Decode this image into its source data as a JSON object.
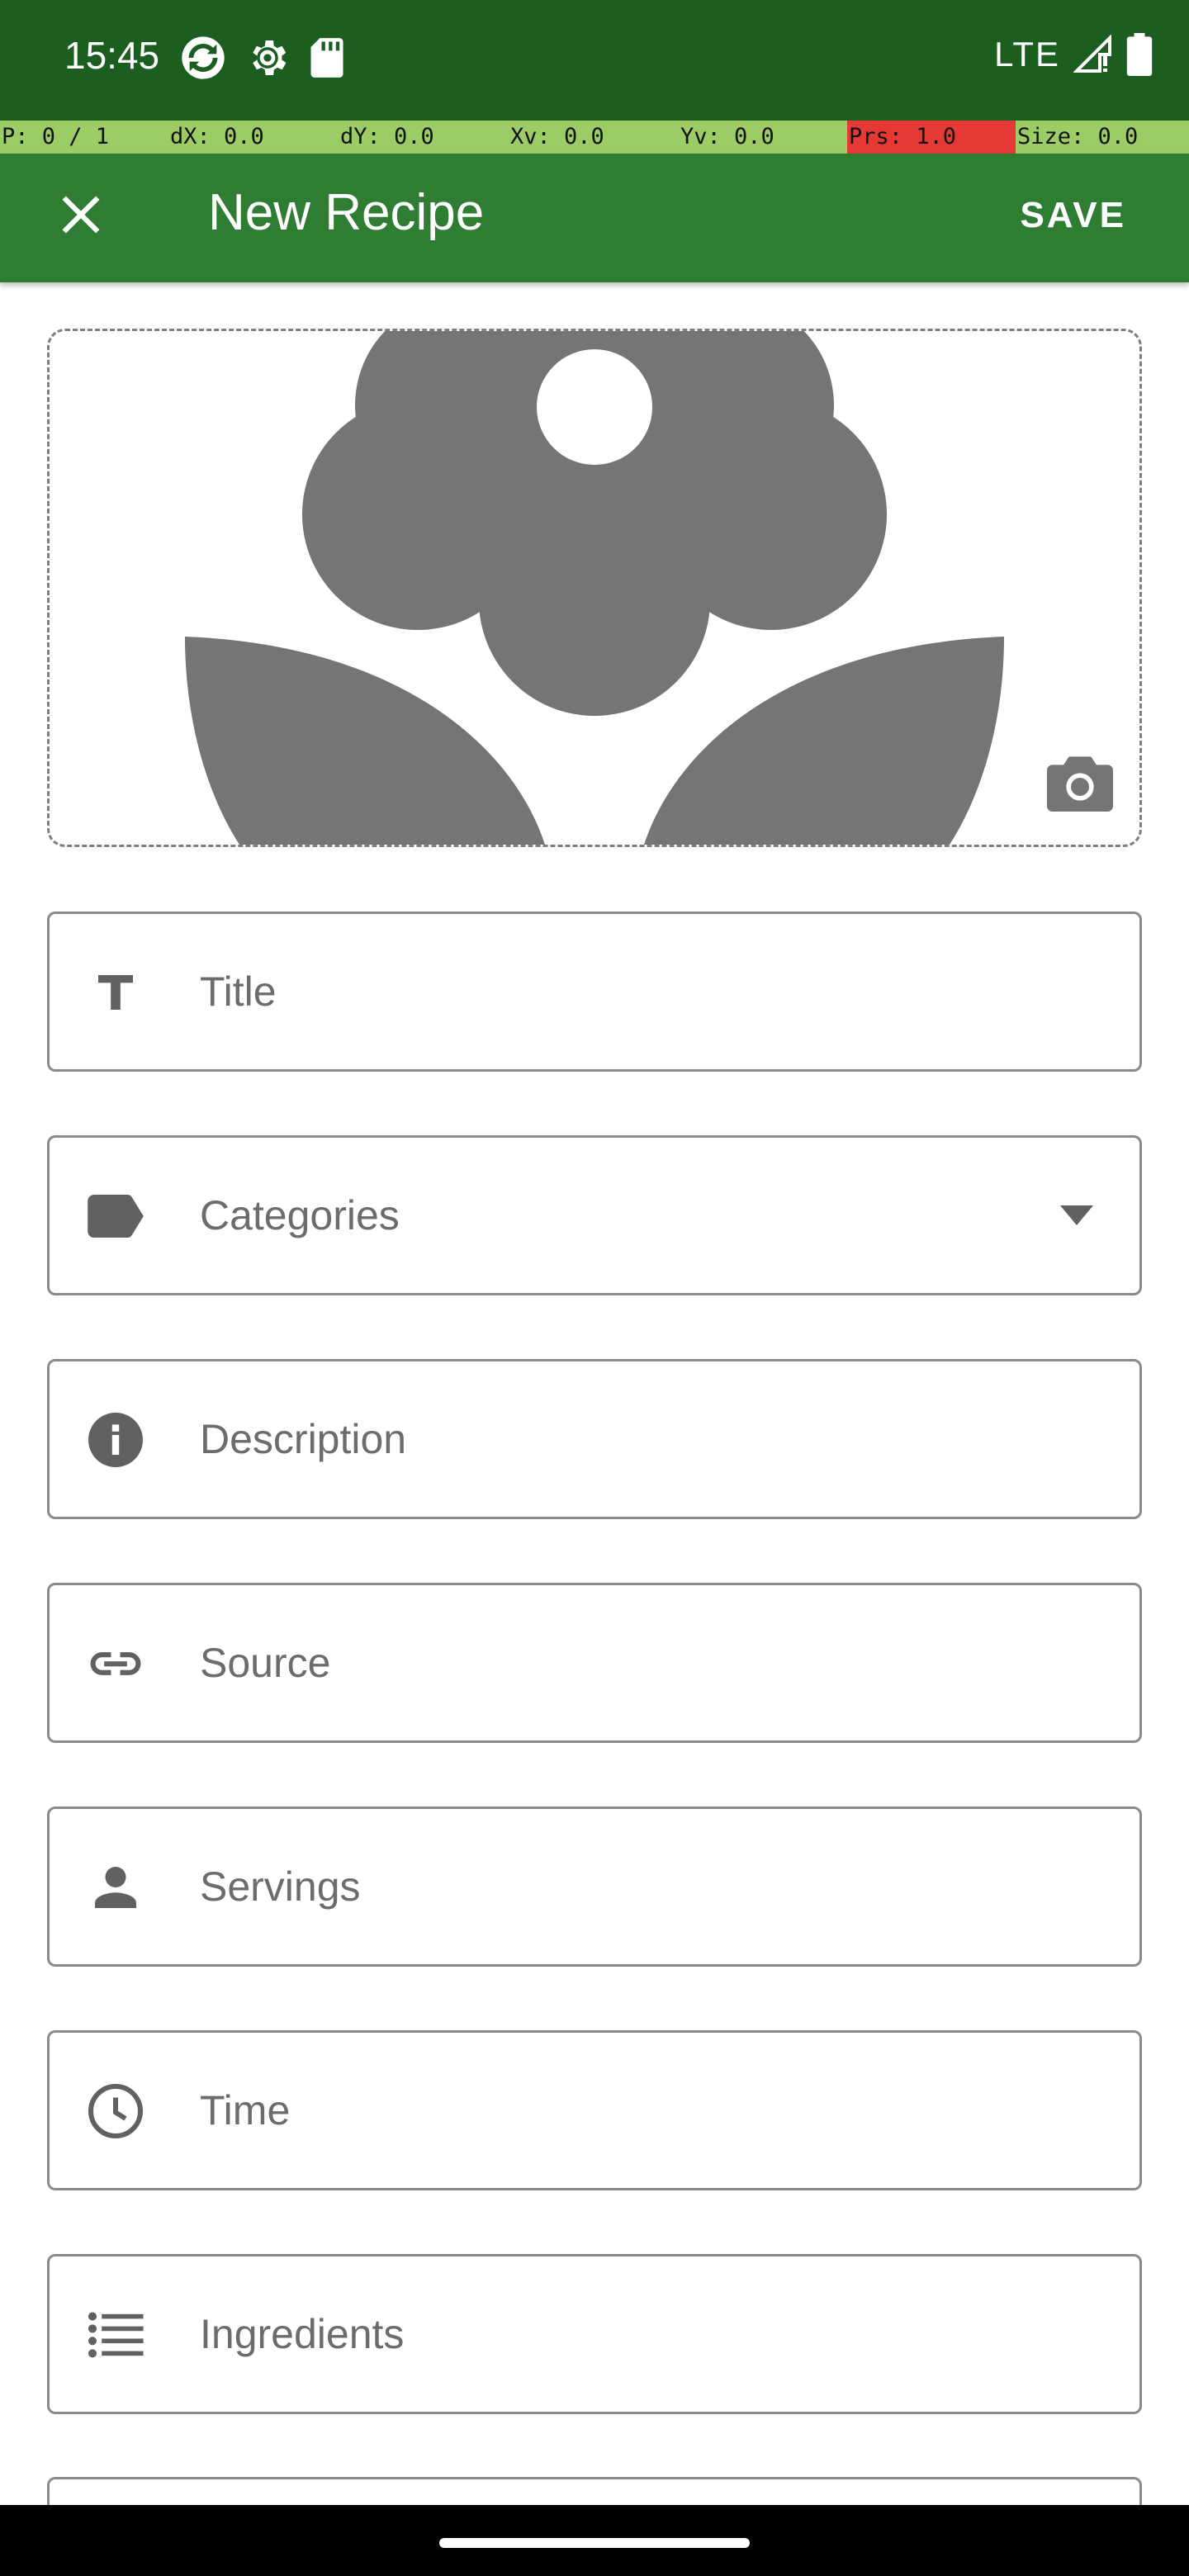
{
  "status_bar": {
    "time": "15:45",
    "network": "LTE",
    "left_icons": [
      "sync-icon",
      "settings-icon",
      "sdcard-icon"
    ],
    "right_icons": [
      "signal-icon",
      "battery-icon"
    ],
    "background": "#1b5e20"
  },
  "overlay": {
    "items": [
      {
        "text": "P: 0 / 1",
        "bg": "#9ccc65"
      },
      {
        "text": "dX: 0.0",
        "bg": "#9ccc65"
      },
      {
        "text": "dY: 0.0",
        "bg": "#9ccc65"
      },
      {
        "text": "Xv: 0.0",
        "bg": "#9ccc65"
      },
      {
        "text": "Yv: 0.0",
        "bg": "#9ccc65"
      },
      {
        "text": "Prs: 1.0",
        "bg": "#e53935"
      },
      {
        "text": "Size: 0.0",
        "bg": "#9ccc65"
      }
    ]
  },
  "app_bar": {
    "title": "New Recipe",
    "save_label": "SAVE",
    "close_icon": "close-icon",
    "background": "#2e7d32"
  },
  "image_picker": {
    "placeholder_icon": "flower-icon",
    "camera_icon": "camera-icon"
  },
  "fields": [
    {
      "label": "Title",
      "icon": "text-icon"
    },
    {
      "label": "Categories",
      "icon": "label-icon",
      "dropdown": true
    },
    {
      "label": "Description",
      "icon": "info-icon"
    },
    {
      "label": "Source",
      "icon": "link-icon"
    },
    {
      "label": "Servings",
      "icon": "person-icon"
    },
    {
      "label": "Time",
      "icon": "clock-icon"
    },
    {
      "label": "Ingredients",
      "icon": "list-icon"
    }
  ]
}
